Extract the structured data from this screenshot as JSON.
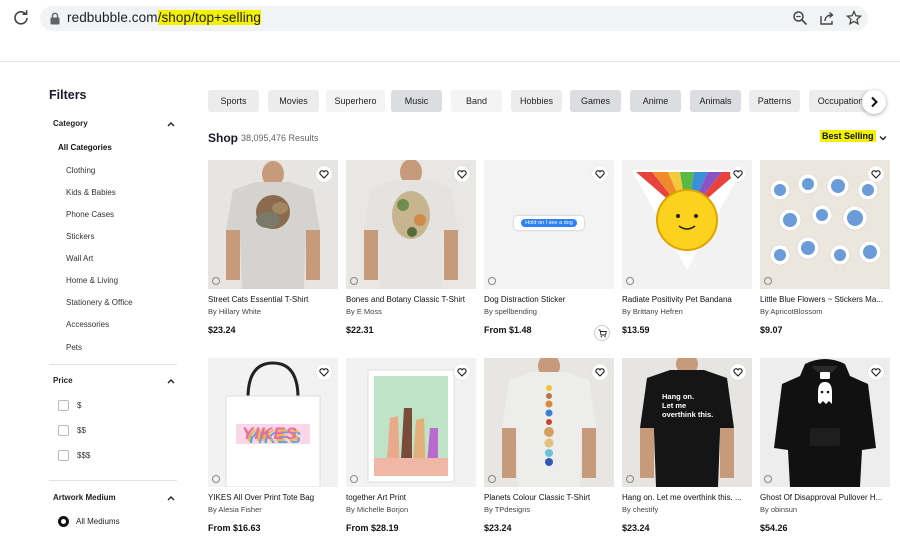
{
  "browser": {
    "url_domain": "redbubble.com",
    "url_path": "/shop/top+selling",
    "icons": [
      "reload-icon",
      "lock-icon",
      "zoom-icon",
      "share-icon",
      "star-icon"
    ]
  },
  "sidebar": {
    "title": "Filters",
    "category": {
      "heading": "Category",
      "items": [
        {
          "label": "All Categories"
        },
        {
          "label": "Clothing"
        },
        {
          "label": "Kids & Babies"
        },
        {
          "label": "Phone Cases"
        },
        {
          "label": "Stickers"
        },
        {
          "label": "Wall Art"
        },
        {
          "label": "Home & Living"
        },
        {
          "label": "Stationery & Office"
        },
        {
          "label": "Accessories"
        },
        {
          "label": "Pets"
        }
      ]
    },
    "price": {
      "heading": "Price",
      "options": [
        {
          "label": "$"
        },
        {
          "label": "$$"
        },
        {
          "label": "$$$"
        }
      ]
    },
    "medium": {
      "heading": "Artwork Medium",
      "options": [
        {
          "label": "All Mediums",
          "selected": true
        }
      ]
    }
  },
  "pills": [
    {
      "label": "Sports",
      "color": "#ececec"
    },
    {
      "label": "Movies",
      "color": "#ececec"
    },
    {
      "label": "Superhero",
      "color": "#f4f4f4"
    },
    {
      "label": "Music",
      "color": "#dcdde0"
    },
    {
      "label": "Band",
      "color": "#f4f4f4"
    },
    {
      "label": "Hobbies",
      "color": "#ececec"
    },
    {
      "label": "Games",
      "color": "#dcdde0"
    },
    {
      "label": "Anime",
      "color": "#dcdde0"
    },
    {
      "label": "Animals",
      "color": "#dcdde0"
    },
    {
      "label": "Patterns",
      "color": "#ececec"
    },
    {
      "label": "Occupation",
      "color": "#ececec"
    }
  ],
  "shop": {
    "title": "Shop",
    "results": "38,095,476 Results",
    "sort_label": "Best Selling"
  },
  "products": [
    {
      "title": "Street Cats Essential T-Shirt",
      "artist": "By Hillary White",
      "price": "$23.24"
    },
    {
      "title": "Bones and Botany Classic T-Shirt",
      "artist": "By E Moss",
      "price": "$22.31"
    },
    {
      "title": "Dog Distraction Sticker",
      "artist": "By spellbending",
      "price": "From $1.48",
      "sticker_text": "Hold on I see a dog"
    },
    {
      "title": "Radiate Positivity Pet Bandana",
      "artist": "By Brittany Hefren",
      "price": "$13.59"
    },
    {
      "title": "Little Blue Flowers ~ Stickers Ma...",
      "artist": "By ApricotBlossom",
      "price": "$9.07"
    },
    {
      "title": "YIKES All Over Print Tote Bag",
      "artist": "By Alesia Fisher",
      "price": "From $16.63",
      "art_text": "YIKES"
    },
    {
      "title": "together Art Print",
      "artist": "By Michelle Borjon",
      "price": "From $28.19"
    },
    {
      "title": "Planets Colour Classic T-Shirt",
      "artist": "By TPdesigns",
      "price": "$23.24"
    },
    {
      "title": "Hang on. Let me overthink this. ...",
      "artist": "By chestify",
      "price": "$23.24",
      "art_text": "Hang on.\nLet me\noverthink this."
    },
    {
      "title": "Ghost Of Disapproval Pullover H...",
      "artist": "By obinsun",
      "price": "$54.26"
    }
  ],
  "colors": {
    "highlight": "#f3f000",
    "pill_gray": "#dcdde0",
    "text": "#111111"
  }
}
